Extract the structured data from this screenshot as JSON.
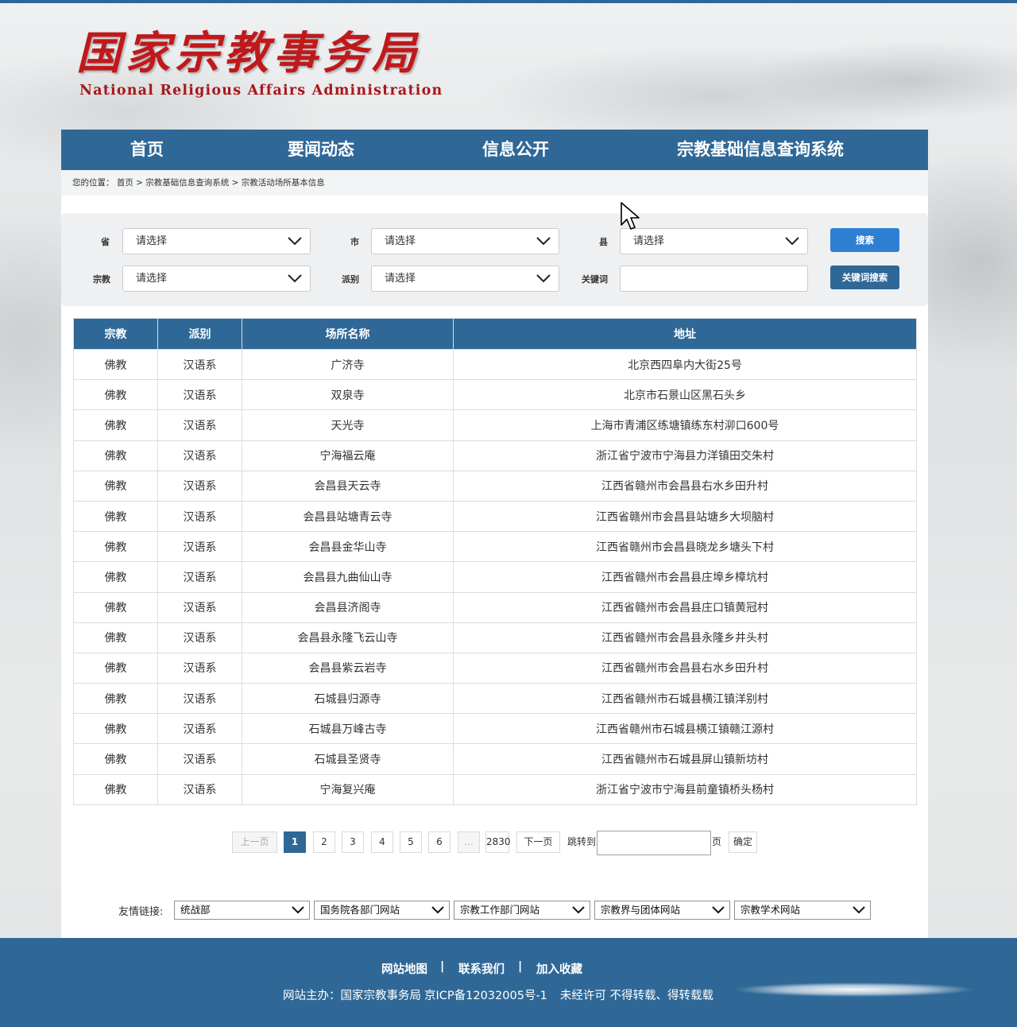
{
  "header": {
    "logo_cn": "国家宗教事务局",
    "logo_en": "National Religious Affairs Administration"
  },
  "nav": {
    "items": [
      "首页",
      "要闻动态",
      "信息公开",
      "宗教基础信息查询系统"
    ]
  },
  "breadcrumb": "您的位置： 首页 > 宗教基础信息查询系统 > 宗教活动场所基本信息",
  "filters": {
    "province_label": "省",
    "city_label": "市",
    "county_label": "县",
    "religion_label": "宗教",
    "sect_label": "派别",
    "keyword_label": "关键词",
    "province_value": "请选择",
    "city_value": "请选择",
    "county_value": "请选择",
    "religion_value": "请选择",
    "sect_value": "请选择",
    "keyword_value": "",
    "search_button": "搜索",
    "keyword_search_button": "关键词搜索"
  },
  "table": {
    "headers": [
      "宗教",
      "派别",
      "场所名称",
      "地址"
    ],
    "rows": [
      [
        "佛教",
        "汉语系",
        "广济寺",
        "北京西四阜内大街25号"
      ],
      [
        "佛教",
        "汉语系",
        "双泉寺",
        "北京市石景山区黑石头乡"
      ],
      [
        "佛教",
        "汉语系",
        "天光寺",
        "上海市青浦区练塘镇练东村泖口600号"
      ],
      [
        "佛教",
        "汉语系",
        "宁海福云庵",
        "浙江省宁波市宁海县力洋镇田交朱村"
      ],
      [
        "佛教",
        "汉语系",
        "会昌县天云寺",
        "江西省赣州市会昌县右水乡田升村"
      ],
      [
        "佛教",
        "汉语系",
        "会昌县站塘青云寺",
        "江西省赣州市会昌县站塘乡大坝脑村"
      ],
      [
        "佛教",
        "汉语系",
        "会昌县金华山寺",
        "江西省赣州市会昌县晓龙乡塘头下村"
      ],
      [
        "佛教",
        "汉语系",
        "会昌县九曲仙山寺",
        "江西省赣州市会昌县庄埠乡樟坑村"
      ],
      [
        "佛教",
        "汉语系",
        "会昌县济阁寺",
        "江西省赣州市会昌县庄口镇黄冠村"
      ],
      [
        "佛教",
        "汉语系",
        "会昌县永隆飞云山寺",
        "江西省赣州市会昌县永隆乡井头村"
      ],
      [
        "佛教",
        "汉语系",
        "会昌县紫云岩寺",
        "江西省赣州市会昌县右水乡田升村"
      ],
      [
        "佛教",
        "汉语系",
        "石城县归源寺",
        "江西省赣州市石城县横江镇洋别村"
      ],
      [
        "佛教",
        "汉语系",
        "石城县万峰古寺",
        "江西省赣州市石城县横江镇赣江源村"
      ],
      [
        "佛教",
        "汉语系",
        "石城县圣贤寺",
        "江西省赣州市石城县屏山镇新坊村"
      ],
      [
        "佛教",
        "汉语系",
        "宁海复兴庵",
        "浙江省宁波市宁海县前童镇桥头杨村"
      ]
    ]
  },
  "pagination": {
    "prev": "上一页",
    "pages": [
      "1",
      "2",
      "3",
      "4",
      "5",
      "6"
    ],
    "current": "1",
    "ellipsis": "...",
    "last": "2830",
    "next": "下一页",
    "jump_label": "跳转到",
    "page_suffix": "页",
    "confirm": "确定",
    "jump_value": ""
  },
  "links": {
    "label": "友情链接:",
    "selects": [
      "统战部",
      "国务院各部门网站",
      "宗教工作部门网站",
      "宗教界与团体网站",
      "宗教学术网站"
    ]
  },
  "footer": {
    "links": [
      "网站地图",
      "|",
      "联系我们",
      "|",
      "加入收藏"
    ],
    "host": "网站主办：国家宗教事务局",
    "icp": "京ICP备12032005号-1",
    "notice": "未经许可 不得转载、得转载载"
  },
  "colors": {
    "primary": "#2f6897",
    "search_button": "#2e7fd1",
    "logo_red": "#c0191b"
  }
}
